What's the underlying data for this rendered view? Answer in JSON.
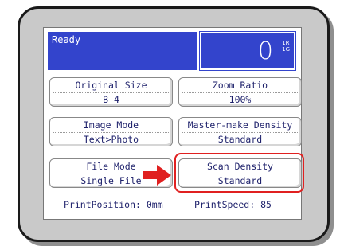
{
  "status": {
    "message": "Ready",
    "copy_count": "0",
    "tray_indicators": [
      "1R",
      "1G"
    ]
  },
  "settings": {
    "original_size": {
      "label": "Original Size",
      "value": "B 4"
    },
    "zoom_ratio": {
      "label": "Zoom Ratio",
      "value": "100%"
    },
    "image_mode": {
      "label": "Image Mode",
      "value": "Text>Photo"
    },
    "master_make_density": {
      "label": "Master-make Density",
      "value": "Standard"
    },
    "file_mode": {
      "label": "File Mode",
      "value": "Single File"
    },
    "scan_density": {
      "label": "Scan Density",
      "value": "Standard"
    }
  },
  "footer": {
    "print_position": "PrintPosition: 0mm",
    "print_speed": "PrintSpeed: 85"
  },
  "colors": {
    "status_bar": "#3344cc",
    "highlight": "#e02020",
    "text": "#1c1f6a"
  }
}
